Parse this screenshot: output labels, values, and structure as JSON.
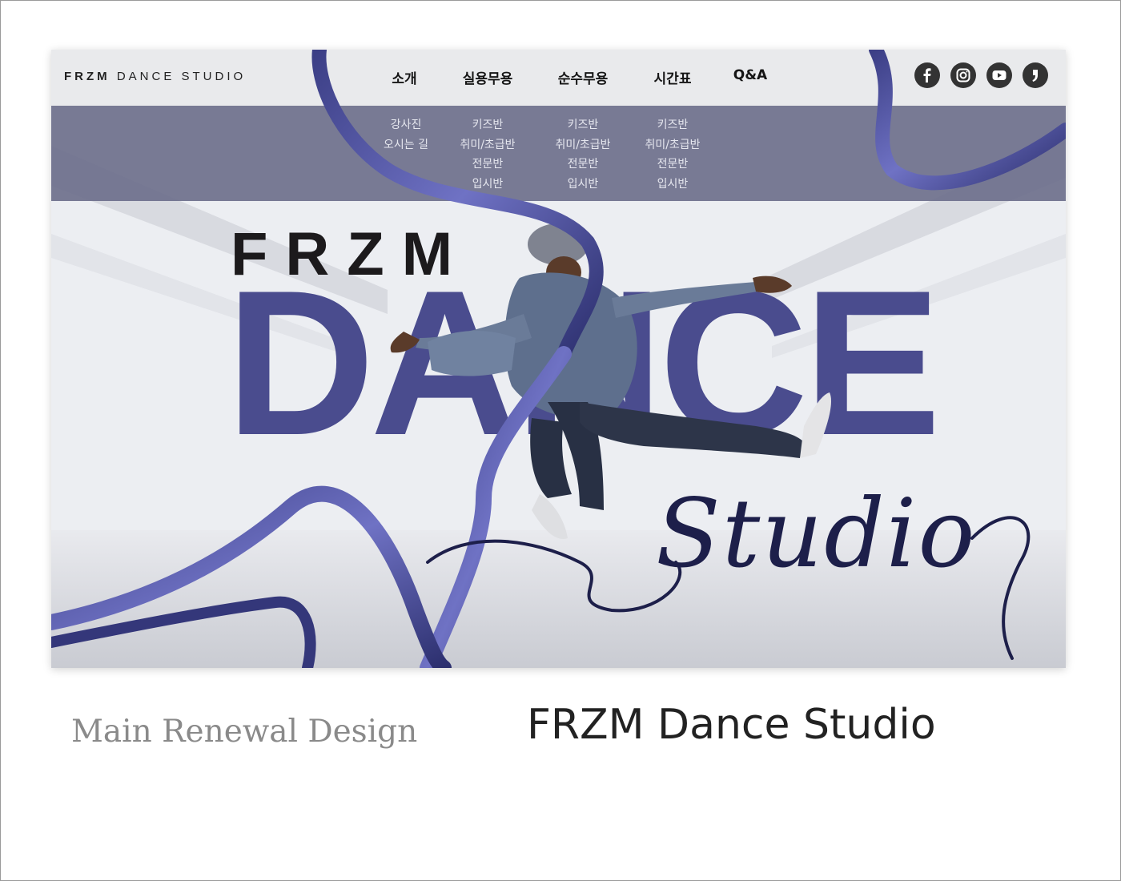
{
  "site": {
    "logo_bold": "FRZM",
    "logo_rest": " DANCE STUDIO",
    "nav": [
      {
        "label": "소개",
        "sub": [
          "강사진",
          "오시는 길"
        ]
      },
      {
        "label": "실용무용",
        "sub": [
          "키즈반",
          "취미/초급반",
          "전문반",
          "입시반"
        ]
      },
      {
        "label": "순수무용",
        "sub": [
          "키즈반",
          "취미/초급반",
          "전문반",
          "입시반"
        ]
      },
      {
        "label": "시간표",
        "sub": [
          "키즈반",
          "취미/초급반",
          "전문반",
          "입시반"
        ]
      },
      {
        "label": "Q&A",
        "sub": []
      }
    ],
    "social_icons": [
      "facebook-icon",
      "instagram-icon",
      "youtube-icon",
      "kakao-story-icon"
    ],
    "hero": {
      "frzm": "FRZM",
      "dance": "DANCE",
      "script": "Studio"
    },
    "colors": {
      "accent": "#4a4c8e",
      "dropdown": "#6e708c",
      "ribbon": "#3f4185"
    }
  },
  "captions": {
    "left": "Main Renewal Design",
    "right": "FRZM Dance Studio"
  }
}
